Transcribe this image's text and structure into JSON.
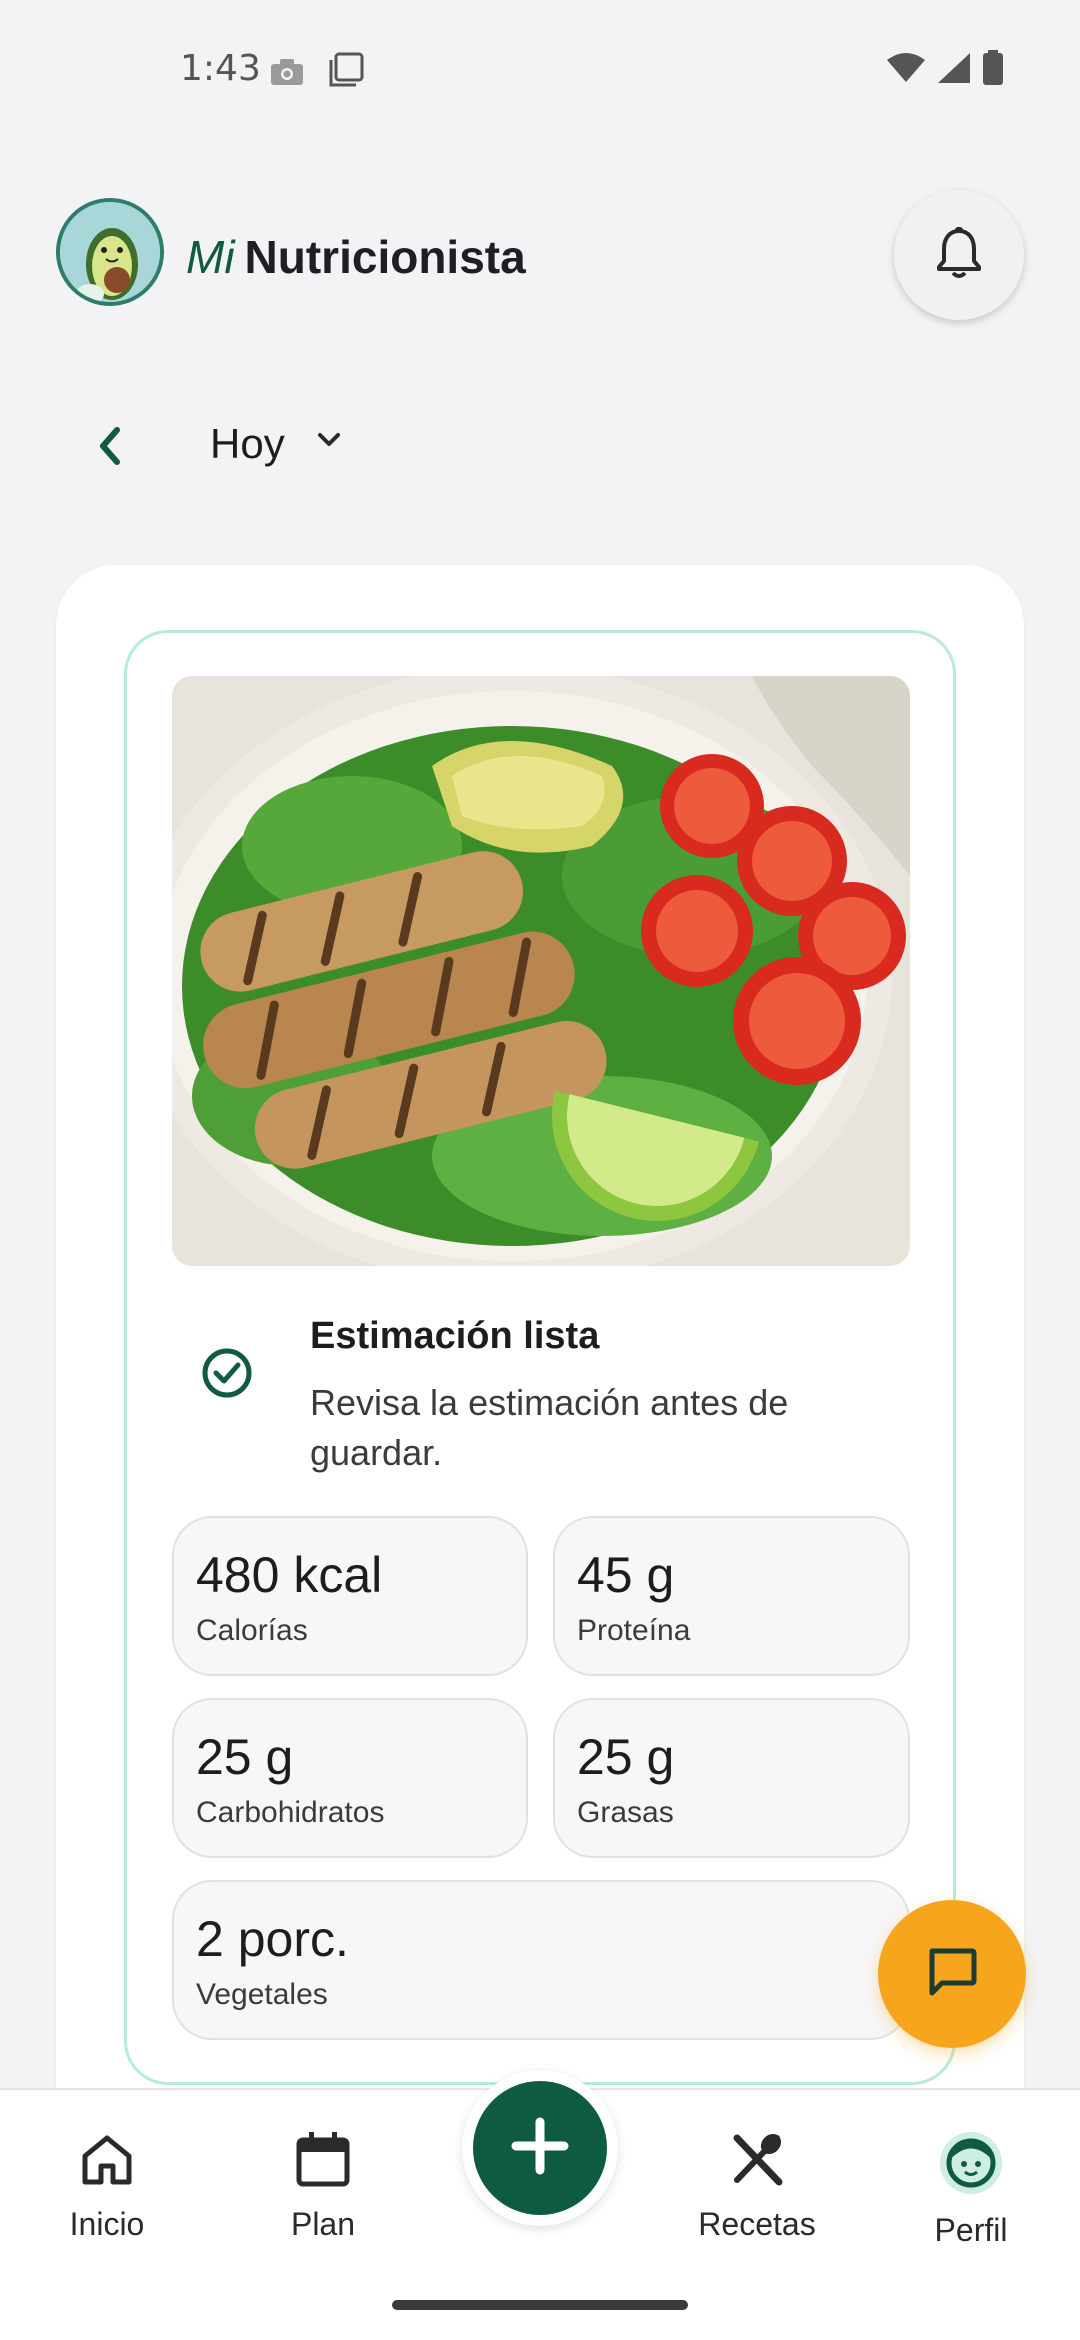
{
  "status_bar": {
    "time": "1:43",
    "icons": [
      "camera-icon",
      "screenshot-icon",
      "wifi-icon",
      "signal-icon",
      "battery-icon"
    ]
  },
  "header": {
    "title_prefix": "Mi",
    "title_main": "Nutricionista",
    "avatar_icon": "avocado-avatar-icon",
    "notification_icon": "bell-icon"
  },
  "date_nav": {
    "back_icon": "chevron-left-icon",
    "label": "Hoy",
    "dropdown_icon": "chevron-down-icon"
  },
  "meal": {
    "image_alt": "grilled-chicken-salad-photo",
    "status_title": "Estimación lista",
    "status_subtitle": "Revisa la estimación antes de guardar.",
    "metrics": [
      {
        "value": "480 kcal",
        "label": "Calorías"
      },
      {
        "value": "45 g",
        "label": "Proteína"
      },
      {
        "value": "25 g",
        "label": "Carbohidratos"
      },
      {
        "value": "25 g",
        "label": "Grasas"
      },
      {
        "value": "2 porc.",
        "label": "Vegetales"
      }
    ]
  },
  "chat_fab_icon": "chat-icon",
  "bottom_nav": {
    "items": [
      {
        "label": "Inicio",
        "icon": "home-icon"
      },
      {
        "label": "Plan",
        "icon": "calendar-icon"
      },
      {
        "label": "Recetas",
        "icon": "utensils-icon"
      },
      {
        "label": "Perfil",
        "icon": "profile-face-icon"
      }
    ],
    "add_icon": "plus-icon"
  },
  "colors": {
    "brand_green": "#0f5a43",
    "accent_orange": "#f7a51d",
    "card_border": "#b7ebd6",
    "background": "#f3f3f5"
  }
}
